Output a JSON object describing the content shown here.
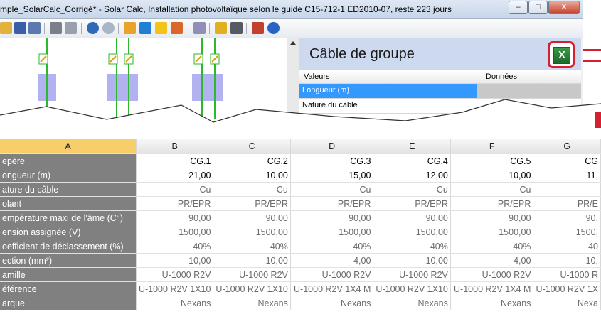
{
  "window": {
    "title": "mple_SolarCalc_Corrigé* - Solar Calc, Installation photovoltaïque selon le guide C15-712-1 ED2010-07, reste 223 jours",
    "controls": [
      "–",
      "□",
      "X"
    ]
  },
  "toolbar": {
    "icons": [
      "open-icon",
      "save-icon",
      "save-as-icon",
      "print-icon",
      "print-preview-icon",
      "undo-icon",
      "redo-icon",
      "edit-icon",
      "component-icon",
      "lightning-icon",
      "chart-icon",
      "stack-icon",
      "key-icon",
      "settings-icon",
      "user-icon",
      "help-icon"
    ]
  },
  "properties": {
    "heading": "Câble de groupe",
    "excel_icon_letter": "X",
    "columns": [
      "Valeurs",
      "Données"
    ],
    "rows": [
      {
        "label": "Longueur (m)",
        "value": ""
      },
      {
        "label": "Nature du câble",
        "value": ""
      }
    ]
  },
  "spreadsheet": {
    "columns": [
      "A",
      "B",
      "C",
      "D",
      "E",
      "F",
      "G"
    ],
    "rows": [
      {
        "label": "epère",
        "values": [
          "CG.1",
          "CG.2",
          "CG.3",
          "CG.4",
          "CG.5",
          "CG"
        ],
        "bold": true
      },
      {
        "label": "ongueur (m)",
        "values": [
          "21,00",
          "10,00",
          "15,00",
          "12,00",
          "10,00",
          "11,"
        ],
        "bold": true
      },
      {
        "label": "ature du câble",
        "values": [
          "Cu",
          "Cu",
          "Cu",
          "Cu",
          "Cu",
          ""
        ],
        "bold": false
      },
      {
        "label": "olant",
        "values": [
          "PR/EPR",
          "PR/EPR",
          "PR/EPR",
          "PR/EPR",
          "PR/EPR",
          "PR/E"
        ],
        "bold": false
      },
      {
        "label": "empérature maxi de l'âme (C°)",
        "values": [
          "90,00",
          "90,00",
          "90,00",
          "90,00",
          "90,00",
          "90,"
        ],
        "bold": false
      },
      {
        "label": "ension assignée (V)",
        "values": [
          "1500,00",
          "1500,00",
          "1500,00",
          "1500,00",
          "1500,00",
          "1500,"
        ],
        "bold": false
      },
      {
        "label": "oefficient de déclassement (%)",
        "values": [
          "40%",
          "40%",
          "40%",
          "40%",
          "40%",
          "40"
        ],
        "bold": false
      },
      {
        "label": "ection (mm²)",
        "values": [
          "10,00",
          "10,00",
          "4,00",
          "10,00",
          "4,00",
          "10,"
        ],
        "bold": false
      },
      {
        "label": "amille",
        "values": [
          "U-1000 R2V",
          "U-1000 R2V",
          "U-1000 R2V",
          "U-1000 R2V",
          "U-1000 R2V",
          "U-1000 R"
        ],
        "bold": false
      },
      {
        "label": "éférence",
        "values": [
          "U-1000 R2V 1X10",
          "U-1000 R2V 1X10",
          "U-1000 R2V 1X4 M",
          "U-1000 R2V 1X10",
          "U-1000 R2V 1X4 M",
          "U-1000 R2V 1X"
        ],
        "bold": false
      },
      {
        "label": "arque",
        "values": [
          "Nexans",
          "Nexans",
          "Nexans",
          "Nexans",
          "Nexans",
          "Nexa"
        ],
        "bold": false
      }
    ]
  },
  "colors": {
    "accent_red": "#d42030",
    "label_bg": "#808080",
    "selection": "#3399ff",
    "active_col": "#f7ce6a"
  }
}
